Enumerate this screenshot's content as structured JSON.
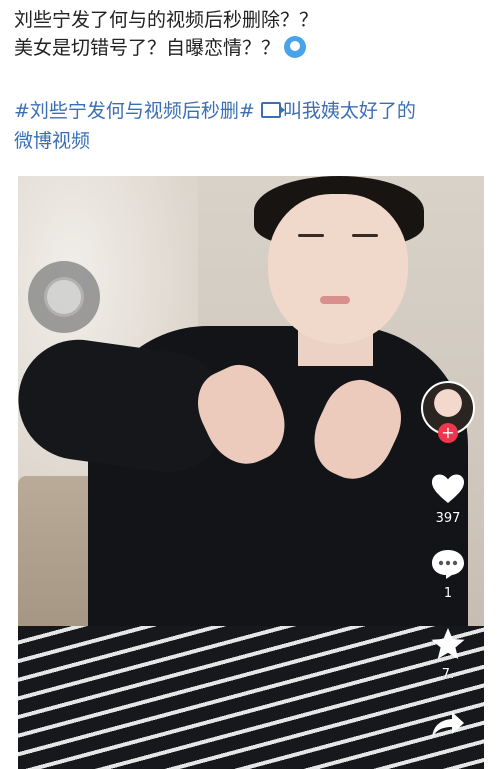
{
  "post": {
    "line1": "刘些宁发了何与的视频后秒删除？？",
    "line2": "美女是切错号了？自曝恋情？？",
    "emoji_icon": "surprised-face-icon"
  },
  "topic": {
    "hashtag": "#刘些宁发何与视频后秒删#",
    "video_link_icon": "video-link-icon",
    "link_text": "叫我姨太好了的",
    "line2": "微博视频"
  },
  "video": {
    "floating_ball_icon": "floating-assistive-ball-icon",
    "side_actions": {
      "avatar": "creator-avatar",
      "follow_icon": "plus-icon",
      "like_icon": "heart-icon",
      "like_count": "397",
      "comment_icon": "comment-icon",
      "comment_count": "1",
      "favorite_icon": "star-icon",
      "favorite_count": "7.",
      "share_icon": "share-icon"
    }
  },
  "colors": {
    "link_blue": "#3b6fb4",
    "follow_red": "#f0364f"
  }
}
